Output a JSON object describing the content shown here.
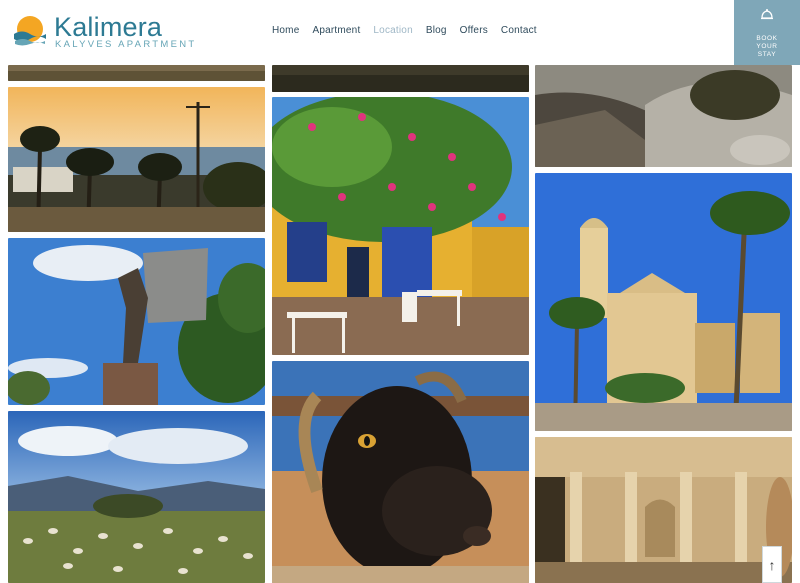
{
  "header": {
    "brand_name": "Kalimera",
    "brand_tagline": "KALYVES APARTMENT",
    "nav": [
      {
        "label": "Home",
        "active": false
      },
      {
        "label": "Apartment",
        "active": false
      },
      {
        "label": "Location",
        "active": true
      },
      {
        "label": "Blog",
        "active": false
      },
      {
        "label": "Offers",
        "active": false
      },
      {
        "label": "Contact",
        "active": false
      }
    ],
    "book": {
      "line1": "BOOK",
      "line2": "YOUR",
      "line3": "STAY",
      "icon": "bell-icon"
    }
  },
  "gallery": [
    "sunset-village-palms",
    "windmill-sculpture",
    "sheep-field-mountains",
    "bougainvillea-taverna",
    "goat-portrait",
    "rocky-hillside",
    "church-square",
    "venetian-fountain"
  ],
  "back_to_top": {
    "icon": "arrow-up-icon",
    "glyph": "↑"
  },
  "colors": {
    "brand": "#2d7a93",
    "book_bg": "#7fa7b8",
    "nav": "#2f4b5c",
    "nav_active": "#9fb7c6"
  }
}
